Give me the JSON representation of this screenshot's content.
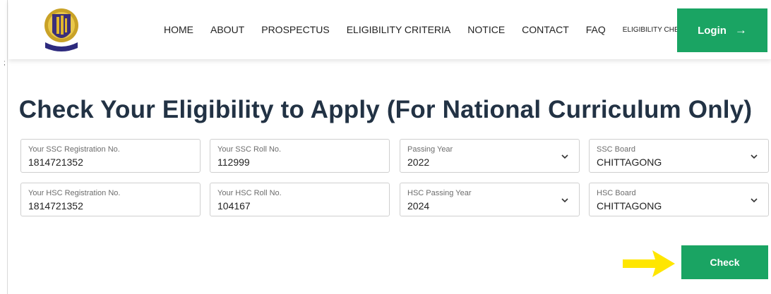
{
  "nav": {
    "links": [
      "HOME",
      "ABOUT",
      "PROSPECTUS",
      "ELIGIBILITY CRITERIA",
      "NOTICE",
      "CONTACT",
      "FAQ",
      "ELIGIBILITY CHECK & APPLY"
    ],
    "login_label": "Login",
    "login_icon": "arrow-right-icon",
    "logo_icon": "university-crest-logo"
  },
  "stray_mark": ";",
  "page_title": "Check Your Eligibility to Apply (For National Curriculum Only)",
  "form": {
    "ssc_registration": {
      "label": "Your SSC Registration No.",
      "value": "1814721352"
    },
    "ssc_roll": {
      "label": "Your SSC Roll No.",
      "value": "112999"
    },
    "ssc_passing_year": {
      "label": "Passing Year",
      "value": "2022"
    },
    "ssc_board": {
      "label": "SSC Board",
      "value": "CHITTAGONG"
    },
    "hsc_registration": {
      "label": "Your HSC Registration No.",
      "value": "1814721352"
    },
    "hsc_roll": {
      "label": "Your HSC Roll No.",
      "value": "104167"
    },
    "hsc_passing_year": {
      "label": "HSC Passing Year",
      "value": "2024"
    },
    "hsc_board": {
      "label": "HSC Board",
      "value": "CHITTAGONG"
    }
  },
  "check_label": "Check",
  "colors": {
    "accent_green": "#1aa463",
    "title_navy": "#223244",
    "annotation_yellow": "#ffe600"
  }
}
